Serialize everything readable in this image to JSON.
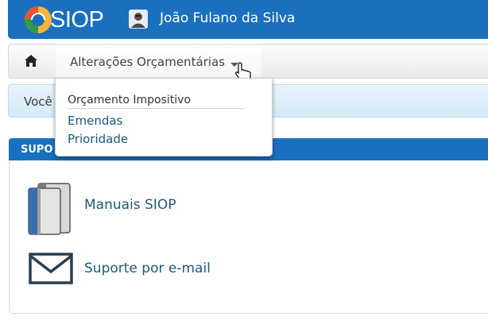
{
  "header": {
    "logo_text": "SIOP",
    "user_name": "João Fulano da Silva"
  },
  "nav": {
    "active_menu_label": "Alterações Orçamentárias"
  },
  "breadcrumb": {
    "text": "Você"
  },
  "dropdown": {
    "heading": "Orçamento Impositivo",
    "items": [
      "Emendas",
      "Prioridade"
    ]
  },
  "support": {
    "title": "SUPO",
    "manuals_label": "Manuais SIOP",
    "email_label": "Suporte por e-mail"
  },
  "colors": {
    "brand_blue": "#1a6fbf",
    "link_blue": "#1b5a7e"
  }
}
